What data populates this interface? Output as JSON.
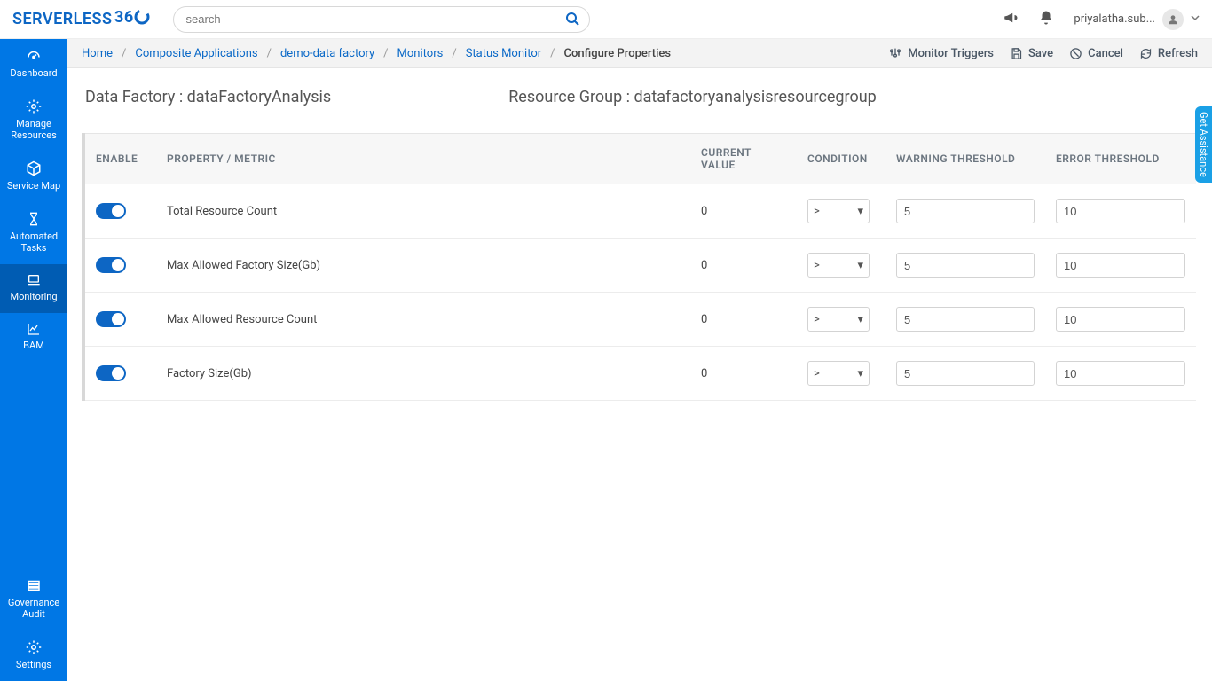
{
  "header": {
    "logo_text": "SERVERLESS",
    "search_placeholder": "search",
    "user_name": "priyalatha.sub..."
  },
  "sidebar": {
    "items": [
      {
        "label": "Dashboard"
      },
      {
        "label": "Manage Resources"
      },
      {
        "label": "Service Map"
      },
      {
        "label": "Automated Tasks"
      },
      {
        "label": "Monitoring"
      },
      {
        "label": "BAM"
      }
    ],
    "bottom": [
      {
        "label": "Governance Audit"
      },
      {
        "label": "Settings"
      }
    ]
  },
  "breadcrumb": {
    "items": [
      {
        "label": "Home"
      },
      {
        "label": "Composite Applications"
      },
      {
        "label": "demo-data factory"
      },
      {
        "label": "Monitors"
      },
      {
        "label": "Status Monitor"
      }
    ],
    "current": "Configure Properties"
  },
  "actions": {
    "monitor_triggers": "Monitor Triggers",
    "save": "Save",
    "cancel": "Cancel",
    "refresh": "Refresh"
  },
  "info": {
    "factory_label": "Data Factory : ",
    "factory_value": "dataFactoryAnalysis",
    "rg_label": "Resource Group : ",
    "rg_value": "datafactoryanalysisresourcegroup"
  },
  "table": {
    "headers": {
      "enable": "ENABLE",
      "metric": "PROPERTY / METRIC",
      "current": "CURRENT VALUE",
      "condition": "CONDITION",
      "warn": "WARNING THRESHOLD",
      "err": "ERROR THRESHOLD"
    },
    "rows": [
      {
        "metric": "Total Resource Count",
        "current": "0",
        "condition": ">",
        "warn": "5",
        "err": "10"
      },
      {
        "metric": "Max Allowed Factory Size(Gb)",
        "current": "0",
        "condition": ">",
        "warn": "5",
        "err": "10"
      },
      {
        "metric": "Max Allowed Resource Count",
        "current": "0",
        "condition": ">",
        "warn": "5",
        "err": "10"
      },
      {
        "metric": "Factory Size(Gb)",
        "current": "0",
        "condition": ">",
        "warn": "5",
        "err": "10"
      }
    ]
  },
  "assist_label": "Get Assistance"
}
